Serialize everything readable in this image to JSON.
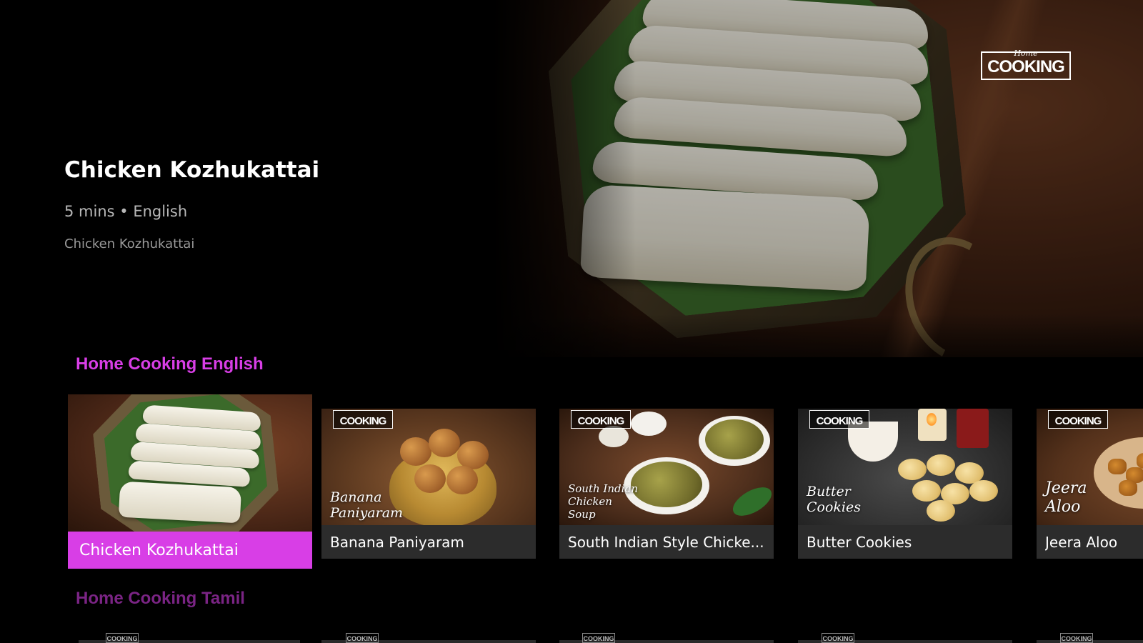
{
  "hero": {
    "title": "Chicken Kozhukattai",
    "meta": "5 mins • English",
    "description": "Chicken Kozhukattai",
    "brand_logo": "COOKING",
    "brand_logo_script": "Home"
  },
  "rows": [
    {
      "title": "Home Cooking English",
      "state": "focused",
      "cards": [
        {
          "label": "Chicken Kozhukattai",
          "focused": true
        },
        {
          "label": "Banana Paniyaram",
          "overlay": "Banana Paniyaram",
          "logo": "COOKING"
        },
        {
          "label": "South Indian Style Chicke...",
          "overlay": "South Indian Chicken Soup",
          "logo": "COOKING"
        },
        {
          "label": "Butter Cookies",
          "overlay": "Butter Cookies",
          "logo": "COOKING"
        },
        {
          "label": "Jeera Aloo",
          "overlay": "Jeera Aloo",
          "logo": "COOKING"
        }
      ]
    },
    {
      "title": "Home Cooking Tamil",
      "state": "unfocused",
      "peek_logo": "COOKING"
    }
  ],
  "colors": {
    "accent": "#d83ee6",
    "accent_dim": "#7a2484",
    "card_label_bg": "#2c2c2c",
    "background": "#000000"
  }
}
